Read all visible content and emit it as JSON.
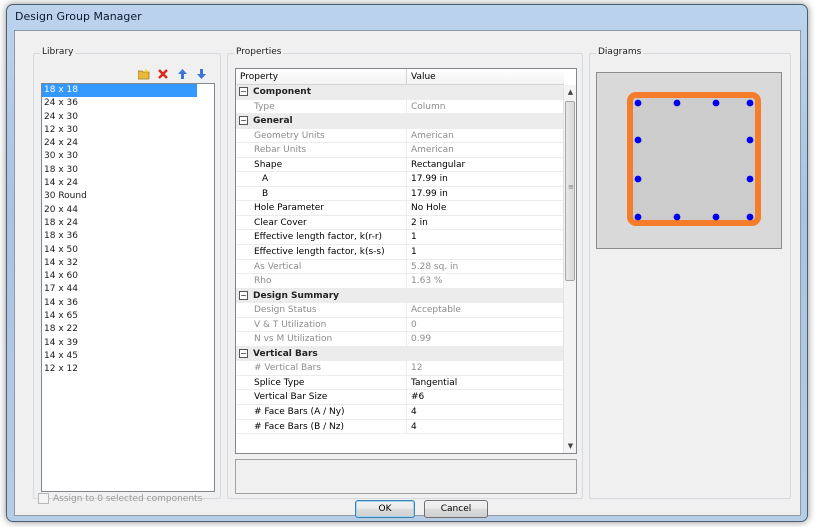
{
  "window": {
    "title": "Design Group Manager"
  },
  "library": {
    "label": "Library",
    "toolbar": {
      "new_icon": "folder-new-icon",
      "delete_icon": "delete-x-icon",
      "up_icon": "arrow-up-icon",
      "down_icon": "arrow-down-icon"
    },
    "items": [
      "18 x 18",
      "24 x 36",
      "24 x 30",
      "12 x 30",
      "24 x 24",
      "30 x 30",
      "18 x 30",
      "14 x 24",
      "30 Round",
      "20 x 44",
      "18 x 24",
      "18 x 36",
      "14 x 50",
      "14 x 32",
      "14 x 60",
      "17 x 44",
      "14 x 36",
      "14 x 65",
      "18 x 22",
      "14 x 39",
      "14 x 45",
      "12 x 12"
    ],
    "selected_index": 0
  },
  "properties": {
    "label": "Properties",
    "columns": {
      "property": "Property",
      "value": "Value"
    },
    "rows": [
      {
        "type": "cat",
        "k": "Component",
        "toggle": "⊟"
      },
      {
        "type": "ro",
        "k": "Type",
        "v": "Column"
      },
      {
        "type": "cat",
        "k": "General",
        "toggle": "⊟"
      },
      {
        "type": "ro",
        "k": "Geometry Units",
        "v": "American"
      },
      {
        "type": "ro",
        "k": "Rebar Units",
        "v": "American"
      },
      {
        "type": "rw",
        "k": "Shape",
        "v": "Rectangular"
      },
      {
        "type": "rw-indent",
        "k": "A",
        "v": "17.99 in"
      },
      {
        "type": "rw-indent",
        "k": "B",
        "v": "17.99 in"
      },
      {
        "type": "rw",
        "k": "Hole Parameter",
        "v": "No Hole"
      },
      {
        "type": "rw",
        "k": "Clear Cover",
        "v": "2 in"
      },
      {
        "type": "rw",
        "k": "Effective length factor, k(r-r)",
        "v": "1"
      },
      {
        "type": "rw",
        "k": "Effective length factor, k(s-s)",
        "v": "1"
      },
      {
        "type": "ro",
        "k": "As Vertical",
        "v": "5.28 sq. in"
      },
      {
        "type": "ro",
        "k": "Rho",
        "v": "1.63 %"
      },
      {
        "type": "cat",
        "k": "Design Summary",
        "toggle": "⊟"
      },
      {
        "type": "ro",
        "k": "Design Status",
        "v": "Acceptable"
      },
      {
        "type": "ro",
        "k": "V & T Utilization",
        "v": "0"
      },
      {
        "type": "ro",
        "k": "N vs M Utilization",
        "v": "0.99"
      },
      {
        "type": "cat",
        "k": "Vertical Bars",
        "toggle": "⊟"
      },
      {
        "type": "ro",
        "k": "# Vertical Bars",
        "v": "12"
      },
      {
        "type": "rw",
        "k": "Splice Type",
        "v": "Tangential"
      },
      {
        "type": "rw",
        "k": "Vertical Bar Size",
        "v": "#6"
      },
      {
        "type": "rw",
        "k": "# Face Bars (A / Ny)",
        "v": "4"
      },
      {
        "type": "rw",
        "k": "# Face Bars (B / Nz)",
        "v": "4"
      }
    ],
    "description": ""
  },
  "diagrams": {
    "label": "Diagrams",
    "colors": {
      "background": "#d9d9d9",
      "section_fill": "#cccccc",
      "outline": "#f47c2a",
      "bar": "#0000ee"
    }
  },
  "footer": {
    "assign_label": "Assign to 0 selected components",
    "ok_label": "OK",
    "cancel_label": "Cancel"
  }
}
